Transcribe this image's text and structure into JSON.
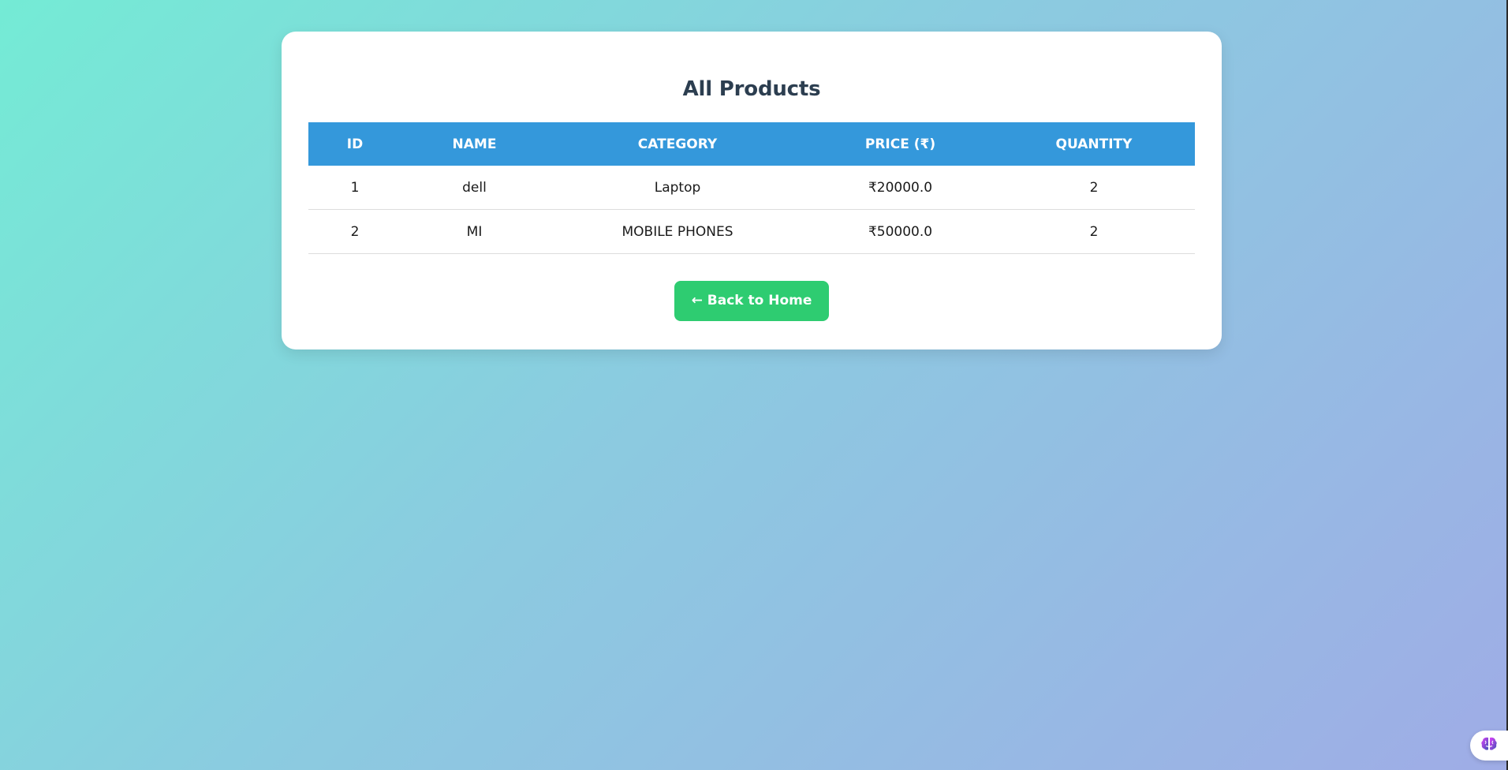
{
  "page": {
    "title": "All Products"
  },
  "table": {
    "headers": [
      "ID",
      "NAME",
      "CATEGORY",
      "PRICE (₹)",
      "QUANTITY"
    ],
    "rows": [
      {
        "id": "1",
        "name": "dell",
        "category": "Laptop",
        "price": "₹20000.0",
        "quantity": "2"
      },
      {
        "id": "2",
        "name": "MI",
        "category": "MOBILE PHONES",
        "price": "₹50000.0",
        "quantity": "2"
      }
    ]
  },
  "actions": {
    "back_label": "← Back to Home"
  },
  "widget": {
    "icon": "brain-icon"
  },
  "colors": {
    "header_bg": "#3498db",
    "button_bg": "#2ecc71",
    "title_text": "#2c3e50"
  }
}
